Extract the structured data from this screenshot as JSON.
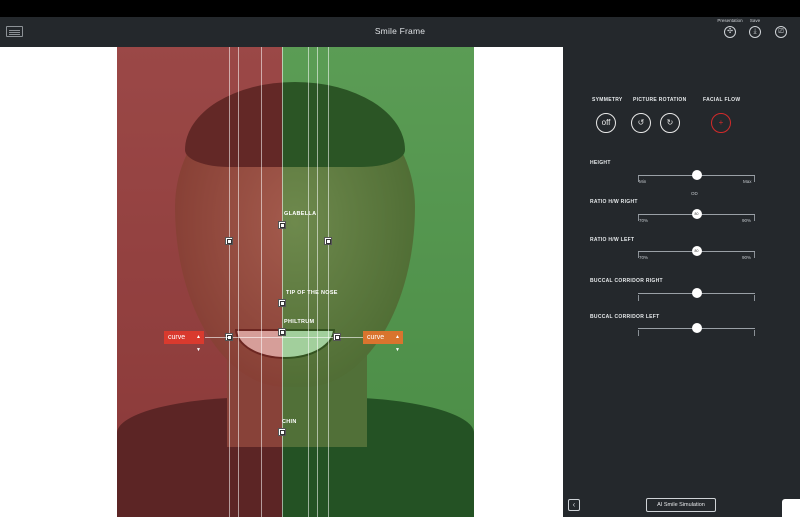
{
  "header": {
    "title": "Smile Frame",
    "presentation_label": "Presentation",
    "save_label": "Save"
  },
  "photo": {
    "left_tint_color": "#b23030",
    "right_tint_color": "#2ea02e",
    "guides": {
      "glabella": "GLABELLA",
      "nose": "TIP OF THE NOSE",
      "philtrum": "PHILTRUM",
      "chin": "CHIN"
    },
    "curve_left": "curve",
    "curve_right": "curve",
    "curve_left_color": "#d93a2e",
    "curve_right_color": "#d9742e"
  },
  "panel": {
    "symmetry_label": "SYMMETRY",
    "symmetry_value": "off",
    "rotation_label": "PICTURE ROTATION",
    "facial_flow_label": "FACIAL FLOW",
    "facial_flow_color": "#d22a2a",
    "height": {
      "label": "HEIGHT",
      "min": "Min",
      "max": "Max",
      "center": "OD",
      "value": 0.5
    },
    "ratio_right": {
      "label": "RATIO H/W RIGHT",
      "min": "70%",
      "max": "90%",
      "knob": "80",
      "value": 0.5
    },
    "ratio_left": {
      "label": "RATIO H/W LEFT",
      "min": "70%",
      "max": "90%",
      "knob": "80",
      "value": 0.5
    },
    "buccal_right": {
      "label": "BUCCAL CORRIDOR RIGHT",
      "value": 0.5
    },
    "buccal_left": {
      "label": "BUCCAL CORRIDOR LEFT",
      "value": 0.5
    },
    "ai_button": "AI Smile Simulation"
  }
}
